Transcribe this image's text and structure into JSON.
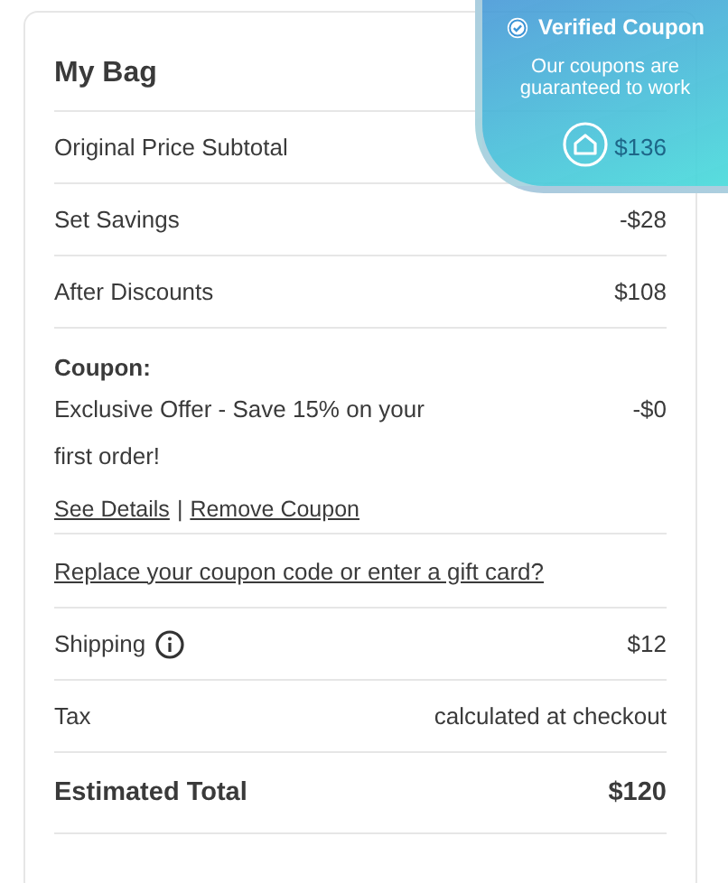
{
  "bag": {
    "title": "My Bag"
  },
  "summary": [
    {
      "label": "Original Price Subtotal",
      "value": "$136"
    },
    {
      "label": "Set Savings",
      "value": "-$28"
    },
    {
      "label": "After Discounts",
      "value": "$108"
    }
  ],
  "coupon": {
    "heading": "Coupon:",
    "description": "Exclusive Offer - Save 15% on your first order!",
    "value": "-$0",
    "links": [
      "See Details",
      "Remove Coupon"
    ],
    "separator": "|"
  },
  "gift_card_link": "Replace your coupon code or enter a gift card?",
  "charges": [
    {
      "label": "Shipping",
      "value": "$12",
      "info": true
    },
    {
      "label": "Tax",
      "value": "calculated at checkout",
      "info": false
    }
  ],
  "total": {
    "label": "Estimated Total",
    "value": "$120"
  },
  "badge": {
    "title": "Verified Coupon",
    "message": "Our coupons are guaranteed to work"
  }
}
